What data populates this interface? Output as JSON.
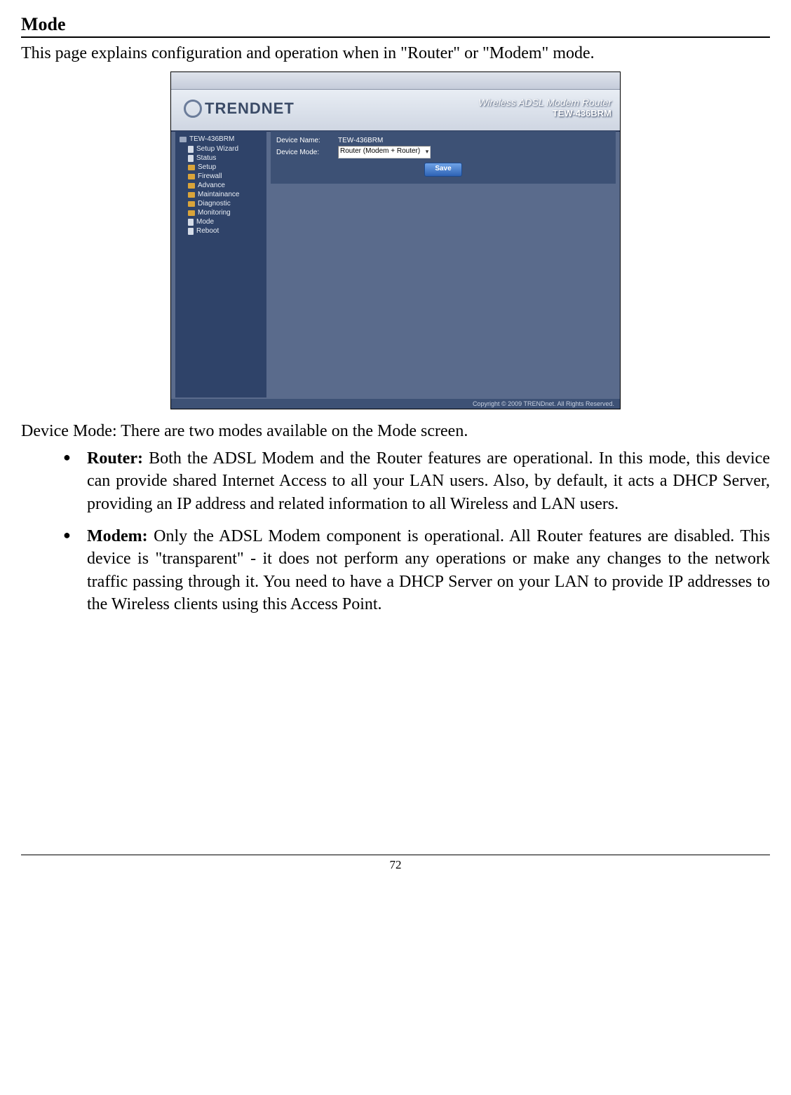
{
  "page": {
    "title": "Mode",
    "intro": "This page explains configuration and operation when in \"Router\" or \"Modem\" mode.",
    "sub": "Device Mode: There are two modes available on the Mode screen.",
    "footer_num": "72"
  },
  "bullets": [
    {
      "label": "Router:",
      "text": " Both the ADSL Modem and the Router features are operational. In this mode, this device can provide shared Internet Access to all your LAN users. Also, by default, it acts a DHCP Server, providing an IP address and related information to all Wireless and LAN users."
    },
    {
      "label": "Modem:",
      "text": " Only the ADSL Modem component is operational. All Router features are disabled. This device is \"transparent\" - it does not perform any operations or make any changes to the network traffic passing through it. You need to have a DHCP Server on your LAN to provide IP addresses to the Wireless clients using this Access Point."
    }
  ],
  "screenshot": {
    "brand": "TRENDNET",
    "product_line1": "Wireless ADSL Modem Router",
    "product_line2": "TEW-436BRM",
    "root": "TEW-436BRM",
    "nav": [
      {
        "icon": "page",
        "label": "Setup Wizard"
      },
      {
        "icon": "page",
        "label": "Status"
      },
      {
        "icon": "folder",
        "label": "Setup"
      },
      {
        "icon": "folder",
        "label": "Firewall"
      },
      {
        "icon": "folder",
        "label": "Advance"
      },
      {
        "icon": "folder",
        "label": "Maintainance"
      },
      {
        "icon": "folder",
        "label": "Diagnostic"
      },
      {
        "icon": "folder",
        "label": "Monitoring"
      },
      {
        "icon": "page",
        "label": "Mode"
      },
      {
        "icon": "page",
        "label": "Reboot"
      }
    ],
    "form": {
      "name_label": "Device Name:",
      "name_value": "TEW-436BRM",
      "mode_label": "Device Mode:",
      "mode_value": "Router (Modem + Router)",
      "save": "Save"
    },
    "copyright": "Copyright © 2009 TRENDnet. All Rights Reserved."
  }
}
